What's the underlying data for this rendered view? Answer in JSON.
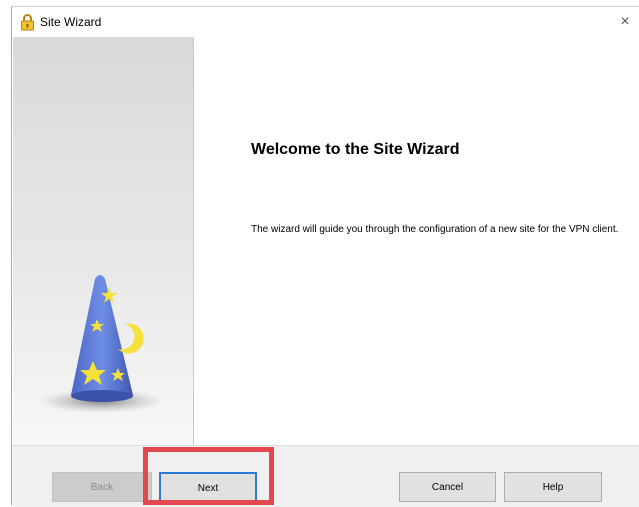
{
  "window": {
    "title": "Site Wizard",
    "close_glyph": "×",
    "title_icon": "padlock-icon"
  },
  "content": {
    "heading": "Welcome to the Site Wizard",
    "description": "The wizard will guide you through the configuration of a new site for the VPN client."
  },
  "side_panel": {
    "illustration": "wizard-hat-icon"
  },
  "buttons": {
    "back": {
      "label": "Back",
      "enabled": false
    },
    "next": {
      "label": "Next",
      "enabled": true,
      "highlighted": true
    },
    "cancel": {
      "label": "Cancel",
      "enabled": true
    },
    "help": {
      "label": "Help",
      "enabled": true
    }
  },
  "colors": {
    "highlight": "#e1484f",
    "focus_border": "#2e79d6",
    "hat_blue": "#5b79d6",
    "star_yellow": "#f5e13c"
  }
}
